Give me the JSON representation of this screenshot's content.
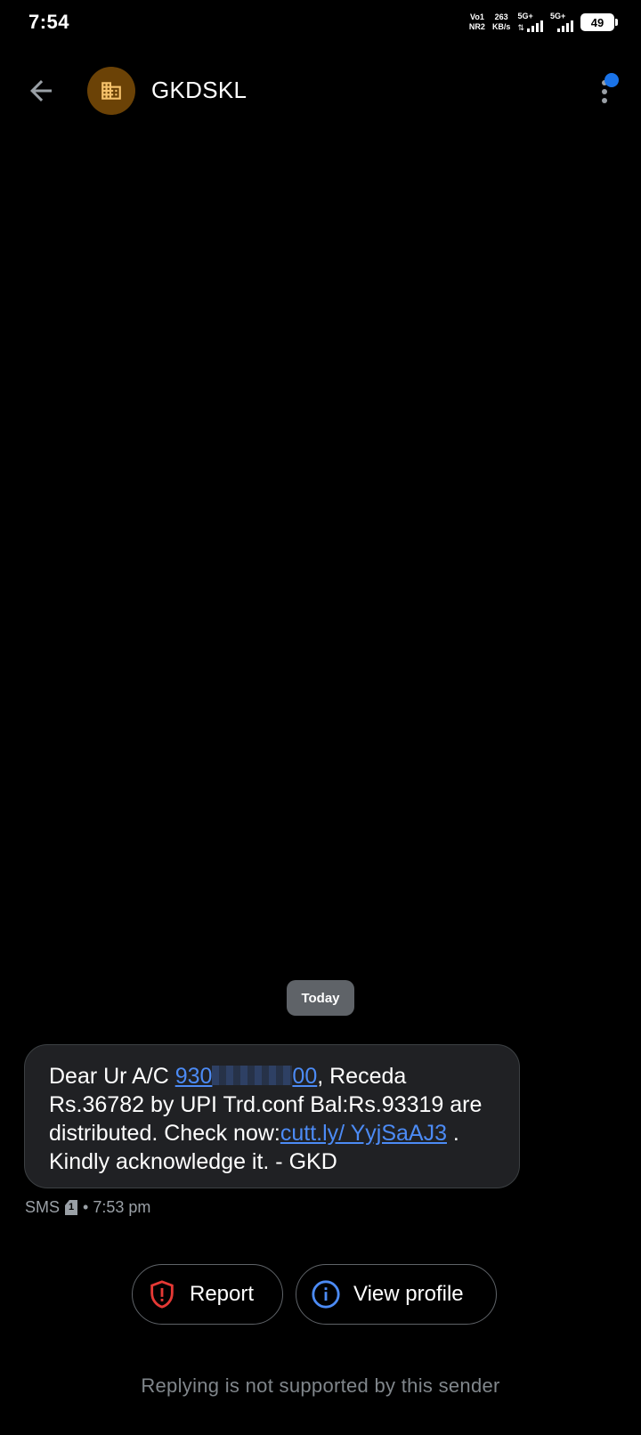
{
  "status_bar": {
    "time": "7:54",
    "volte_top": "Vo1",
    "volte_bottom": "NR2",
    "speed_value": "263",
    "speed_unit": "KB/s",
    "sim1_label": "5G+",
    "sim2_label": "5G+",
    "battery": "49"
  },
  "app_bar": {
    "contact_name": "GKDSKL",
    "avatar_icon": "business-building-icon",
    "avatar_color": "#6b4206"
  },
  "conversation": {
    "date_chip": "Today",
    "message": {
      "part1": "Dear Ur A/C ",
      "account_prefix": "930",
      "account_suffix": "00",
      "part2": ", Receda Rs.36782 by UPI Trd.conf Bal:Rs.93319 are distributed. Check now:",
      "link_text": "cutt.ly/ YyjSaAJ3",
      "part3": " . Kindly acknowledge it. - GKD"
    },
    "meta": {
      "type": "SMS",
      "sim_slot": "1",
      "time": "• 7:53 pm"
    }
  },
  "actions": {
    "report_label": "Report",
    "view_profile_label": "View profile"
  },
  "footer_note": "Replying is not supported by this sender",
  "colors": {
    "background": "#000000",
    "bubble": "#202124",
    "link": "#4c8bf5",
    "report_icon": "#e53935",
    "info_icon": "#4c8bf5",
    "notification_dot": "#1a73e8"
  }
}
